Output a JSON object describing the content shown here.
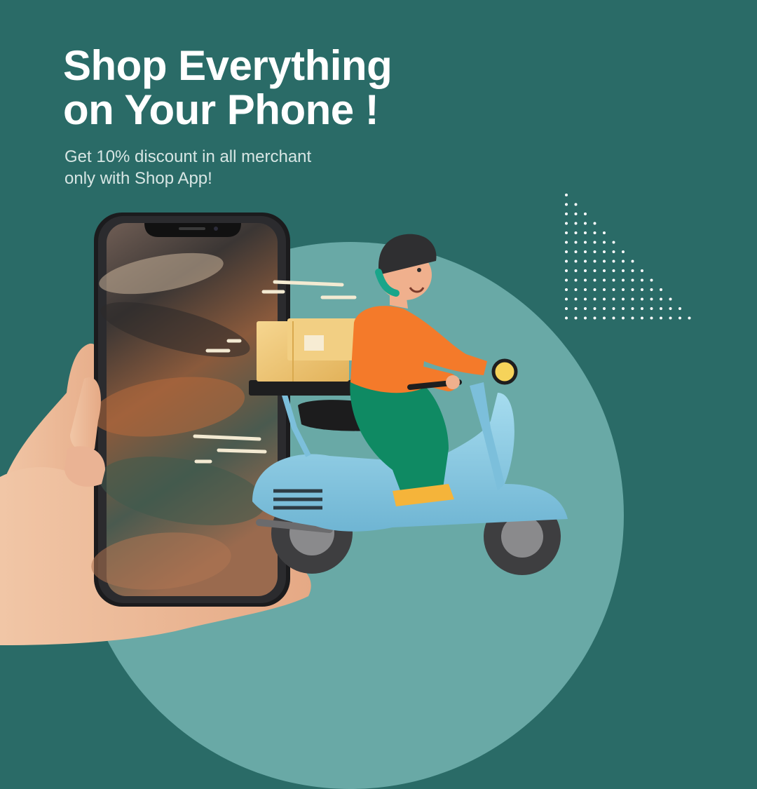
{
  "banner": {
    "headline_line1": "Shop Everything",
    "headline_line2": "on Your Phone !",
    "subtext_line1": "Get 10% discount in all merchant",
    "subtext_line2": "only with Shop App!"
  },
  "colors": {
    "background": "#2a6b67",
    "circle": "#69a9a6",
    "text": "#ffffff",
    "scooter": "#86c8e2",
    "shirt": "#f47a2a",
    "pants": "#0f8a63",
    "box": "#f0c873"
  },
  "illustration": {
    "icons": [
      "hand-holding-phone-icon",
      "delivery-rider-on-scooter-icon",
      "package-box-icon",
      "dot-pattern-icon"
    ]
  }
}
